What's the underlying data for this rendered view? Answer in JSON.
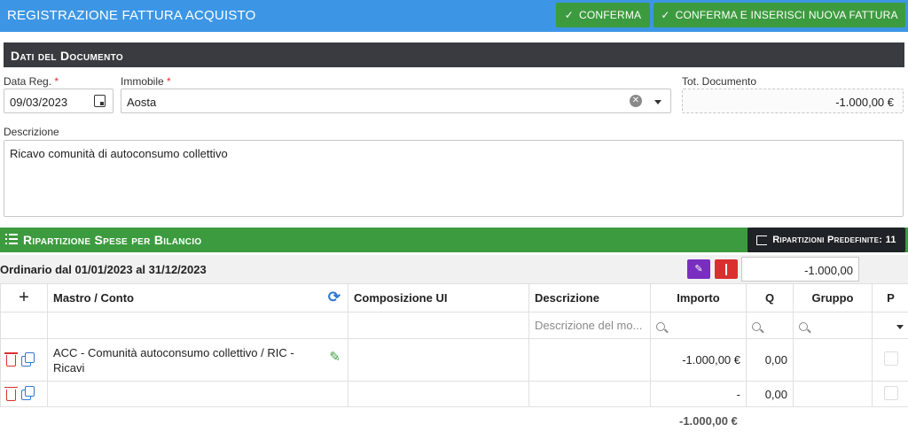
{
  "header": {
    "title": "REGISTRAZIONE FATTURA ACQUISTO",
    "btn_conferma": "CONFERMA",
    "btn_conferma_nuova": "CONFERMA E INSERISCI NUOVA FATTURA"
  },
  "document": {
    "section_title": "Dati del Documento",
    "data_reg_label": "Data Reg.",
    "data_reg_value": "09/03/2023",
    "immobile_label": "Immobile",
    "immobile_value": "Aosta",
    "tot_label": "Tot. Documento",
    "tot_value": "-1.000,00 €",
    "descrizione_label": "Descrizione",
    "descrizione_value": "Ricavo comunità di autoconsumo collettivo",
    "required_mark": "*"
  },
  "ripartizione": {
    "section_title": "Ripartizione Spese per Bilancio",
    "btn_predefinite": "Ripartizioni Predefinite: 11",
    "period_label": "Ordinario dal 01/01/2023 al 31/12/2023",
    "period_amount": "-1.000,00"
  },
  "table": {
    "add_symbol": "+",
    "columns": {
      "mastro": "Mastro / Conto",
      "composizione": "Composizione UI",
      "descrizione": "Descrizione",
      "importo": "Importo",
      "q": "Q",
      "gruppo": "Gruppo",
      "p": "P"
    },
    "filter_descrizione_placeholder": "Descrizione del mo...",
    "rows": [
      {
        "conto_line1": "ACC - Comunità autoconsumo collettivo / RIC -",
        "conto_line2": "Ricavi",
        "importo": "-1.000,00 €",
        "q": "0,00"
      },
      {
        "conto_line1": "",
        "conto_line2": "",
        "importo": "-",
        "q": "0,00"
      }
    ],
    "total": "-1.000,00 €"
  },
  "colors": {
    "header_blue": "#3c96e5",
    "action_green": "#3d9b3f",
    "section_dark": "#393b40",
    "danger_red": "#d9302f",
    "purple": "#7a2ec0"
  }
}
